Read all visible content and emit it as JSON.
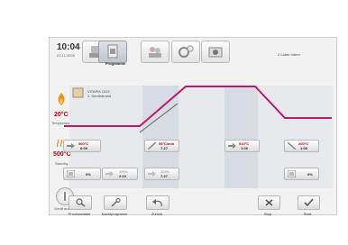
{
  "status": {
    "time": "10:04",
    "date": "20.11.2008"
  },
  "tabs": [
    {
      "name": "oven",
      "label": ""
    },
    {
      "name": "programme",
      "label": "Programme"
    },
    {
      "name": "users",
      "label": ""
    },
    {
      "name": "settings",
      "label": ""
    },
    {
      "name": "camera",
      "label": ""
    }
  ],
  "user_indicator": "2 Laber intern",
  "program": {
    "name": "VITAPM 1013",
    "sub": "1. Dentinbrand"
  },
  "left_panel": {
    "temperature": "20°C",
    "temperature_label": "Temperatur",
    "standby": "500°C",
    "standby_label": "Standby",
    "power_label": "Gerät aus"
  },
  "steps_top": [
    {
      "temp": "500°C",
      "time": "6:00"
    },
    {
      "temp": "55°C/min",
      "time": "7:27"
    },
    {
      "temp": "910°C",
      "time": "1:00"
    },
    {
      "temp": "200°C",
      "time": "1:00"
    }
  ],
  "steps_bottom": [
    {
      "text": "0%"
    },
    {
      "text": "100%",
      "time": "2:10"
    },
    {
      "text": "100%",
      "time": "7:27"
    },
    {
      "text": "0%"
    }
  ],
  "buttons": {
    "process": "Prozessdaten",
    "post": "Nachtprogramm",
    "back": "Zurück",
    "stop": "Stop",
    "start": "Start"
  },
  "colors": {
    "curve": "#c0186a",
    "accent": "#c00000"
  }
}
